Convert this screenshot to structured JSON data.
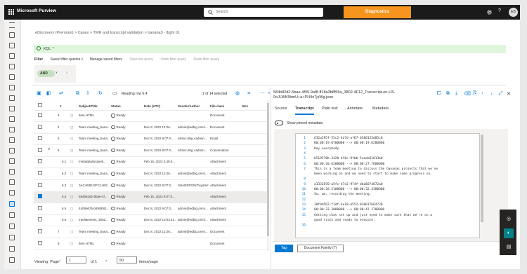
{
  "header": {
    "app_title": "Microsoft Purview",
    "search_placeholder": "Search",
    "diagnostics_label": "Diagnostics",
    "avatar_initials": "EB",
    "brand_color": "#1b1b1b",
    "diagnostics_color": "#f7941d"
  },
  "breadcrumbs": [
    "eDiscovery (Premium)",
    "Cases",
    "TMR and transcript validation",
    "banana3 - flight 01"
  ],
  "query": {
    "kql_label": "KQL: *",
    "filter_label": "Filter",
    "actions": [
      "Saved filter queries",
      "Manage saved filters",
      "Save the query",
      "Undo filter query",
      "Redo filter query"
    ],
    "and_label": "AND"
  },
  "toolbar": {
    "reading_label": "Reading row 6.4",
    "selection_count": "1 of 14 selected"
  },
  "grid": {
    "columns": [
      "#",
      "Subject/Title",
      "Status",
      "Date (UTC)",
      "Sender/Author",
      "File class",
      "Bcc"
    ],
    "rows": [
      {
        "num": "3",
        "subject": "item.HTML",
        "status": "Ready",
        "date": "",
        "sender": "",
        "fileclass": "Document",
        "selected": false
      },
      {
        "num": "4",
        "subject": "Team meeting_bana...",
        "status": "Ready",
        "date": "Dec 8, 2022 12:26...",
        "sender": "admin@edbig.onmi...",
        "fileclass": "Document",
        "selected": false
      },
      {
        "num": "5",
        "subject": "Team meeting_bana...",
        "status": "Ready",
        "date": "Dec 8, 2022 9:07:0...",
        "sender": "eDisco Big <admin...",
        "fileclass": "Email",
        "selected": false
      },
      {
        "num": "6",
        "subject": "Team meeting_bana...",
        "status": "Ready",
        "date": "Dec 8, 2022 9:07:0...",
        "sender": "eDisco Big <admin...",
        "fileclass": "Conversation",
        "selected": false
      },
      {
        "num": "6.1",
        "subject": "metadata/properti...",
        "status": "Ready",
        "date": "Feb 16, 2023 3:49:5...",
        "sender": "",
        "fileclass": "Attachment",
        "selected": false
      },
      {
        "num": "6.2",
        "subject": "Team meeting_bana...",
        "status": "Ready",
        "date": "Dec 8, 2022 12:26...",
        "sender": "admin@edbig.onmi...",
        "fileclass": "Attachment",
        "selected": false
      },
      {
        "num": "6.3",
        "subject": "0AC463E22FC14EE...",
        "status": "Ready",
        "date": "Dec 8, 2022 9:07:0...",
        "sender": "SHAREPOINT\\system",
        "fileclass": "Attachment",
        "selected": false
      },
      {
        "num": "6.4",
        "subject": "584b82d2-5bae-4f...",
        "status": "Ready",
        "date": "Feb 15, 2023 9:07:0...",
        "sender": "",
        "fileclass": "Attachment",
        "selected": true
      },
      {
        "num": "6.5",
        "subject": "44059675-0495E82...",
        "status": "Ready",
        "date": "Dec 8, 2022 9:07:0...",
        "sender": "admin@edbig.onmi...",
        "fileclass": "Attachment",
        "selected": false
      },
      {
        "num": "6.6",
        "subject": "mediaevents_3802...",
        "status": "Ready",
        "date": "Dec 8, 2022 10:03:42...",
        "sender": "admin@edbig.onmi...",
        "fileclass": "Attachment",
        "selected": false
      },
      {
        "num": "7",
        "subject": "Team meeting_bana...",
        "status": "Ready",
        "date": "Dec 8, 2022 12:26...",
        "sender": "admin@edbig.onmi...",
        "fileclass": "Document",
        "selected": false
      },
      {
        "num": "8",
        "subject": "item.HTML",
        "status": "Ready",
        "date": "",
        "sender": "",
        "fileclass": "Document",
        "selected": false
      }
    ]
  },
  "pager": {
    "viewing_label": "Viewing: Page",
    "page_value": "1",
    "of_label": "of 1",
    "page_size": "50",
    "items_label": "items/page"
  },
  "detail": {
    "title": "584b82d2-5bae-4f99-9af8-ff18a3b8f55a_3802-4F12_Transcript-en-US-0oJLWK5bmU+a+PH4o7jxWg.json",
    "tabs": [
      "Source",
      "Transcript",
      "Plain text",
      "Annotate",
      "Metadata"
    ],
    "active_tab": 1,
    "toggle_label": "Show pinned metadata",
    "transcript_lines": [
      {
        "n": "1",
        "t": "632a295f-55c2-4a7d-af67-6306123d05c8"
      },
      {
        "n": "2",
        "t": "00:00:19.0700000 --> 00:00:19.6200000"
      },
      {
        "n": "3",
        "t": "Hey everybody."
      },
      {
        "n": "4",
        "t": ""
      },
      {
        "n": "5",
        "t": "b519570b-3420-4f6c-9fbb-5eade61013b0"
      },
      {
        "n": "6",
        "t": "00:00:20.6200000 --> 00:00:27.7600000"
      },
      {
        "n": "7",
        "t": "This is a team meeting to discuss the bananas projects that we've"
      },
      {
        "n": "",
        "t": "been working on and we need to start to make some progress on."
      },
      {
        "n": "8",
        "t": ""
      },
      {
        "n": "9",
        "t": "a1332870-a5fc-47e2-974f-dba66f4872a0"
      },
      {
        "n": "10",
        "t": "00:00:28.5100000 --> 00:00:32.4300000"
      },
      {
        "n": "11",
        "t": "So, um, recording the meeting."
      },
      {
        "n": "12",
        "t": ""
      },
      {
        "n": "13",
        "t": "30f9d562-f1df-4e19-b552-030017664730"
      },
      {
        "n": "14",
        "t": "00:00:33.3000000 --> 00:00:42.2700000"
      },
      {
        "n": "15",
        "t": "Getting that set up and just need to make sure that we're on a"
      },
      {
        "n": "",
        "t": "good track and ready to execute."
      },
      {
        "n": "16",
        "t": ""
      }
    ],
    "tag_label": "Tag",
    "family_label": "Document Family (7)"
  },
  "icons": {
    "accent_color": "#0078d4"
  }
}
